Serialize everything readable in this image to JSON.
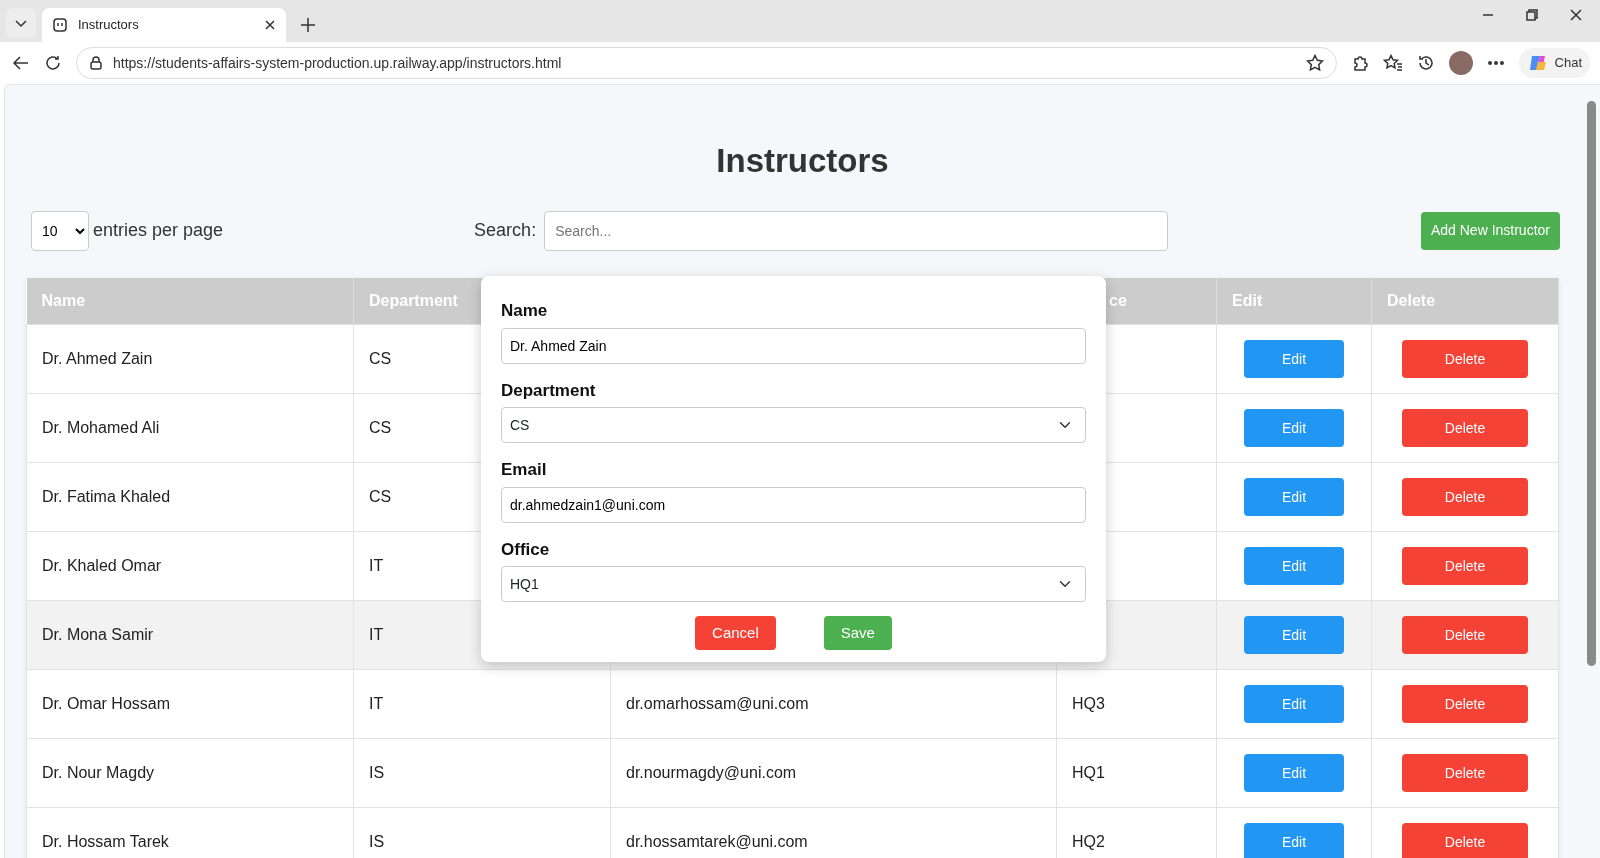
{
  "browser": {
    "tab_title": "Instructors",
    "url": "https://students-affairs-system-production.up.railway.app/instructors.html",
    "chat_label": "Chat"
  },
  "page": {
    "title": "Instructors",
    "page_size": "10",
    "page_size_label": "entries per page",
    "search_label": "Search:",
    "search_placeholder": "Search...",
    "add_button": "Add New Instructor"
  },
  "table": {
    "columns": [
      "Name",
      "Department",
      null,
      "ce",
      "Edit",
      "Delete"
    ],
    "rows": [
      {
        "name": "Dr. Ahmed Zain",
        "department": "CS",
        "edit": "Edit",
        "delete": "Delete",
        "highlighted": false
      },
      {
        "name": "Dr. Mohamed Ali",
        "department": "CS",
        "edit": "Edit",
        "delete": "Delete",
        "highlighted": false
      },
      {
        "name": "Dr. Fatima Khaled",
        "department": "CS",
        "edit": "Edit",
        "delete": "Delete",
        "highlighted": false
      },
      {
        "name": "Dr. Khaled Omar",
        "department": "IT",
        "edit": "Edit",
        "delete": "Delete",
        "highlighted": false
      },
      {
        "name": "Dr. Mona Samir",
        "department": "IT",
        "edit": "Edit",
        "delete": "Delete",
        "highlighted": true
      },
      {
        "name": "Dr. Omar Hossam",
        "department": "IT",
        "email": "dr.omarhossam@uni.com",
        "office": "HQ3",
        "edit": "Edit",
        "delete": "Delete",
        "highlighted": false
      },
      {
        "name": "Dr. Nour Magdy",
        "department": "IS",
        "email": "dr.nourmagdy@uni.com",
        "office": "HQ1",
        "edit": "Edit",
        "delete": "Delete",
        "highlighted": false
      },
      {
        "name": "Dr. Hossam Tarek",
        "department": "IS",
        "email": "dr.hossamtarek@uni.com",
        "office": "HQ2",
        "edit": "Edit",
        "delete": "Delete",
        "highlighted": false
      }
    ]
  },
  "modal": {
    "fields": [
      {
        "kind": "text",
        "label": "Name",
        "value": "Dr. Ahmed Zain"
      },
      {
        "kind": "select",
        "label": "Department",
        "value": "CS"
      },
      {
        "kind": "text",
        "label": "Email",
        "value": "dr.ahmedzain1@uni.com"
      },
      {
        "kind": "select",
        "label": "Office",
        "value": "HQ1"
      }
    ],
    "buttons": [
      {
        "kind": "cancel",
        "label": "Cancel"
      },
      {
        "kind": "save",
        "label": "Save"
      }
    ]
  }
}
